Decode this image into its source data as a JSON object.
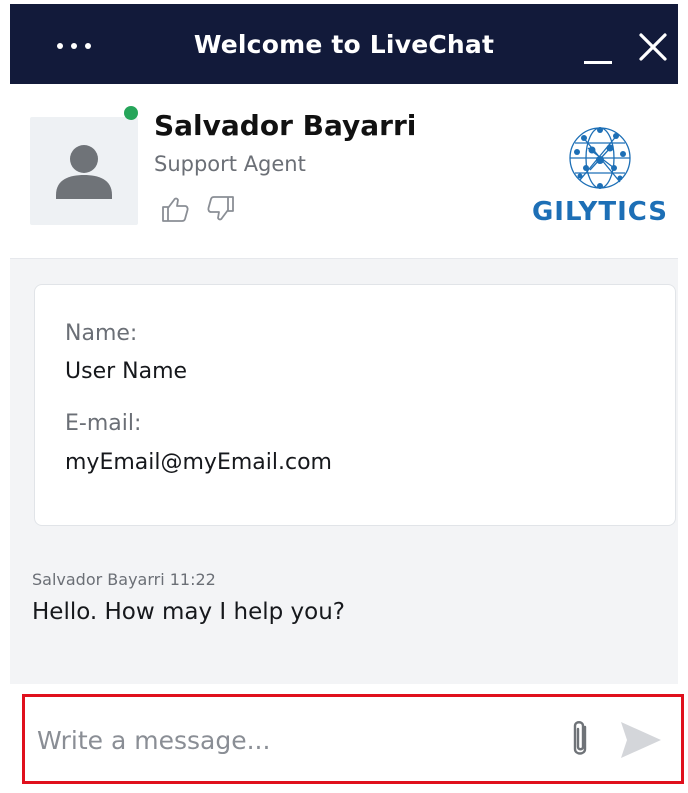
{
  "window": {
    "title": "Welcome to LiveChat",
    "menu_icon": "more-horizontal-icon",
    "minimize_icon": "minimize-icon",
    "close_icon": "close-icon",
    "bar_color": "#121a3a"
  },
  "agent": {
    "name": "Salvador Bayarri",
    "role": "Support Agent",
    "status_color": "#26a55a",
    "avatar_icon": "user-silhouette-icon",
    "rate_up_icon": "thumbs-up-icon",
    "rate_down_icon": "thumbs-down-icon"
  },
  "brand": {
    "logo_text": "GILYTICS",
    "logo_icon": "network-globe-icon",
    "color": "#1d6fb6"
  },
  "form_card": {
    "name_label": "Name:",
    "name_value": "User Name",
    "email_label": "E-mail:",
    "email_value": "myEmail@myEmail.com"
  },
  "messages": [
    {
      "author": "Salvador Bayarri",
      "time": "11:22",
      "meta": "Salvador Bayarri 11:22",
      "text": "Hello. How may I help you?"
    }
  ],
  "composer": {
    "placeholder": "Write a message...",
    "value": "",
    "attach_icon": "paperclip-icon",
    "send_icon": "send-icon",
    "highlight_color": "#e0101d"
  }
}
